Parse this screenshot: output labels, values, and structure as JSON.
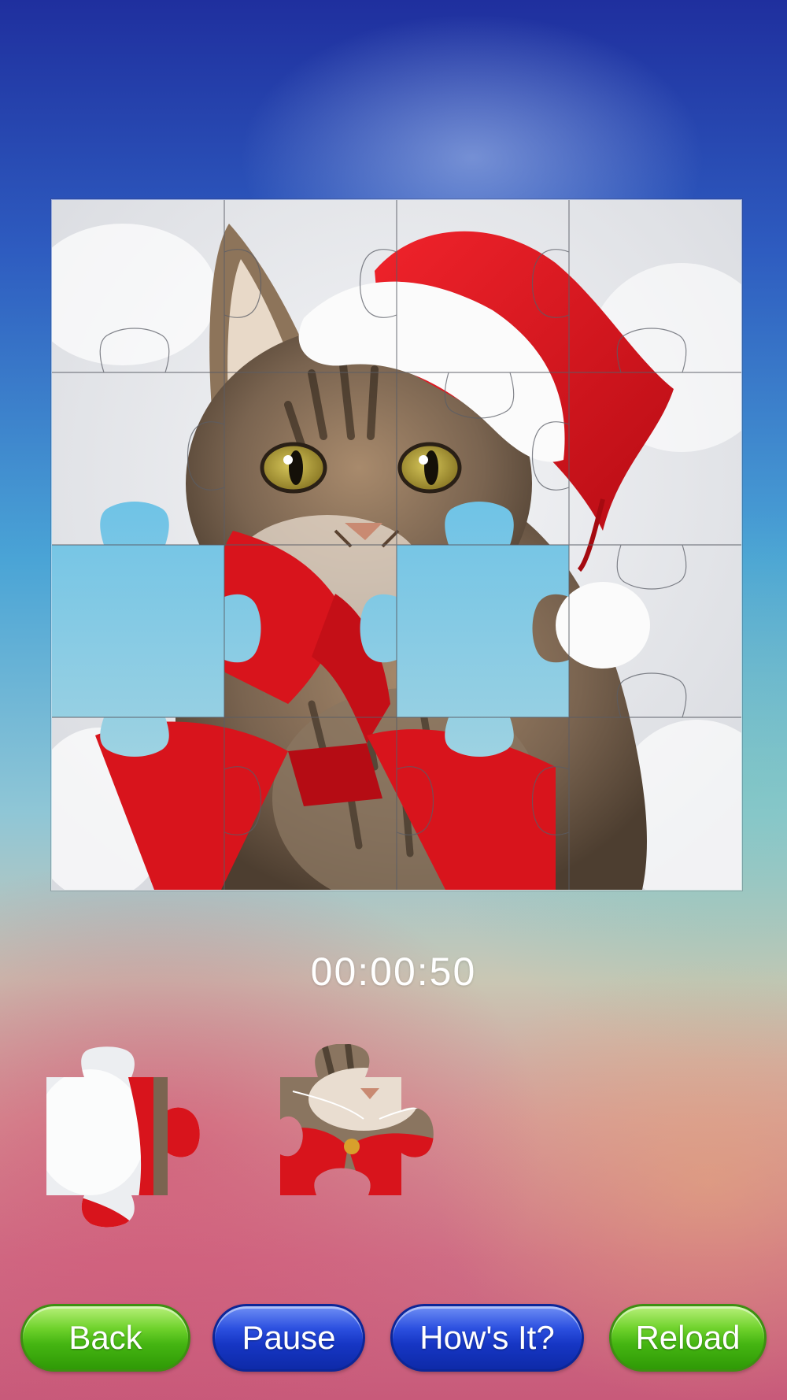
{
  "game": {
    "timer": "00:00:50",
    "board": {
      "rows": 4,
      "cols": 4,
      "image": "christmas-kitten-santa-hat",
      "missing_pieces": [
        {
          "row": 2,
          "col": 0
        },
        {
          "row": 2,
          "col": 2
        }
      ]
    },
    "tray_pieces": [
      {
        "name": "tray-piece-1",
        "image": "white-fur-red-scarf-piece"
      },
      {
        "name": "tray-piece-2",
        "image": "kitten-chin-red-bow-piece"
      }
    ]
  },
  "buttons": {
    "back": "Back",
    "pause": "Pause",
    "hows_it": "How's It?",
    "reload": "Reload"
  },
  "colors": {
    "green_button": "#45b512",
    "blue_button": "#1636c4",
    "hat_red": "#d8141c",
    "board_background": "#eef0f3"
  }
}
